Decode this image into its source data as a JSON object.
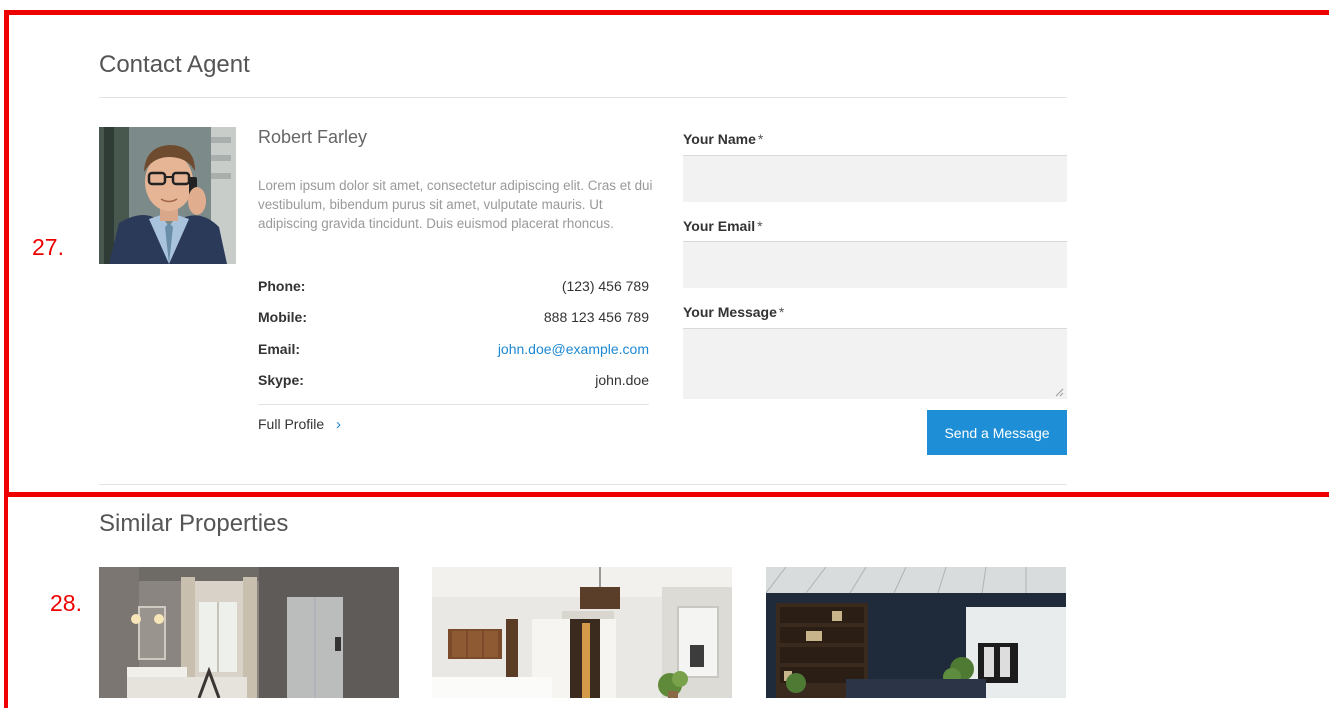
{
  "annotations": {
    "box1": "27.",
    "box2": "28."
  },
  "contact": {
    "title": "Contact Agent",
    "agent": {
      "name": "Robert Farley",
      "bio": "Lorem ipsum dolor sit amet, consectetur adipiscing elit. Cras et dui vestibulum, bibendum purus sit amet, vulputate mauris. Ut adipiscing gravida tincidunt. Duis euismod placerat rhoncus.",
      "details": [
        {
          "label": "Phone:",
          "value": "(123) 456 789"
        },
        {
          "label": "Mobile:",
          "value": "888 123 456 789"
        },
        {
          "label": "Email:",
          "value": "john.doe@example.com"
        },
        {
          "label": "Skype:",
          "value": "john.doe"
        }
      ],
      "profile_link": "Full Profile",
      "profile_icon": "chevron-right-icon"
    },
    "form": {
      "name_label": "Your Name",
      "email_label": "Your Email",
      "message_label": "Your Message",
      "required_mark": "*",
      "name_value": "",
      "email_value": "",
      "message_value": "",
      "submit_label": "Send a Message"
    }
  },
  "similar": {
    "title": "Similar Properties",
    "items": [
      {
        "image": "bathroom-photo"
      },
      {
        "image": "bedroom-photo"
      },
      {
        "image": "living-room-photo"
      }
    ]
  },
  "colors": {
    "accent": "#1e8fd6",
    "annotation": "#ee0000",
    "field_bg": "#f2f2f2"
  }
}
